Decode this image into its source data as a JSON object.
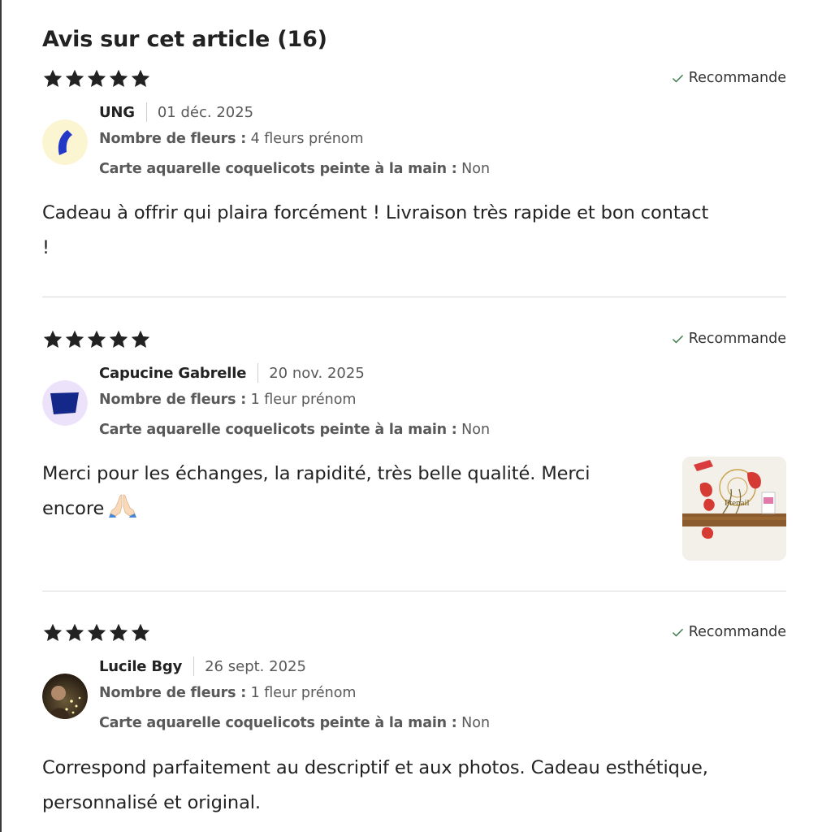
{
  "section": {
    "title": "Avis sur cet article (16)"
  },
  "colors": {
    "star": "#222222",
    "check": "#3b7a4b",
    "muted_text": "#595959",
    "divider": "#d9d9d9"
  },
  "reviews": [
    {
      "rating": 5,
      "recommend_label": "Recommande",
      "author": "UNG",
      "date": "01 déc. 2025",
      "variations": [
        {
          "label": "Nombre de fleurs :",
          "value": "4 fleurs prénom"
        },
        {
          "label": "Carte aquarelle coquelicots peinte à la main :",
          "value": "Non"
        }
      ],
      "text_lines": [
        "Cadeau à offrir qui plaira forcément ! Livraison très rapide et bon contact",
        "!"
      ],
      "avatar": "avatar-blue-crescent-icon"
    },
    {
      "rating": 5,
      "recommend_label": "Recommande",
      "author": "Capucine Gabrelle",
      "date": "20 nov. 2025",
      "variations": [
        {
          "label": "Nombre de fleurs :",
          "value": "1 fleur prénom"
        },
        {
          "label": "Carte aquarelle coquelicots peinte à la main :",
          "value": "Non"
        }
      ],
      "text_lines": [
        "Merci pour les échanges, la rapidité, très belle qualité. Merci",
        "encore"
      ],
      "emoji": "praying-hands-emoji",
      "has_photo": true,
      "avatar": "avatar-navy-shape-icon"
    },
    {
      "rating": 5,
      "recommend_label": "Recommande",
      "author": "Lucile Bgy",
      "date": "26 sept. 2025",
      "variations": [
        {
          "label": "Nombre de fleurs :",
          "value": "1 fleur prénom"
        },
        {
          "label": "Carte aquarelle coquelicots peinte à la main :",
          "value": "Non"
        }
      ],
      "text_lines": [
        "Correspond parfaitement au descriptif et aux photos. Cadeau esthétique,",
        "personnalisé et original."
      ],
      "avatar": "avatar-photo"
    }
  ]
}
